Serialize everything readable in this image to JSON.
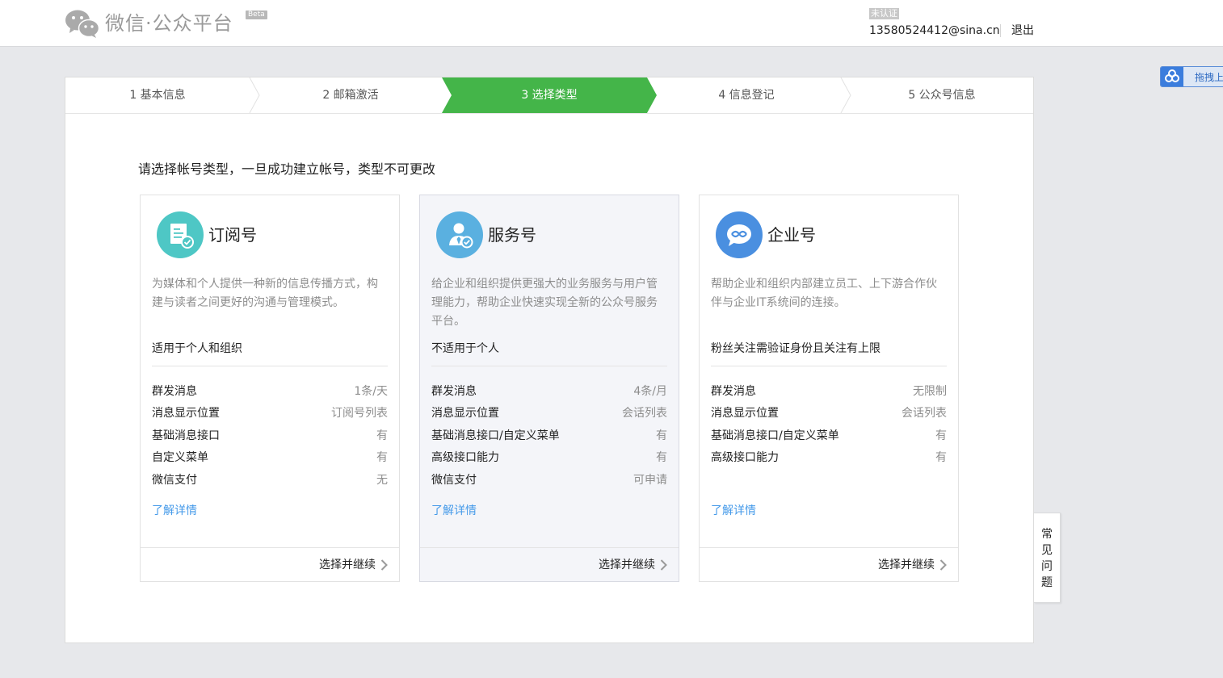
{
  "header": {
    "logo_text": "微信·公众平台",
    "beta": "Beta",
    "account_status": "未认证",
    "account_email": "13580524412@sina.cn",
    "logout": "退出"
  },
  "widgets": {
    "drag_label": "拖拽上",
    "faq_label": "常见问题"
  },
  "steps": [
    {
      "label": "1 基本信息",
      "active": false
    },
    {
      "label": "2 邮箱激活",
      "active": false
    },
    {
      "label": "3 选择类型",
      "active": true
    },
    {
      "label": "4 信息登记",
      "active": false
    },
    {
      "label": "5 公众号信息",
      "active": false
    }
  ],
  "prompt": "请选择帐号类型，一旦成功建立帐号，类型不可更改",
  "cards": [
    {
      "title": "订阅号",
      "icon": "subscription-doc-icon",
      "icon_color": "#4ec7c5",
      "desc": "为媒体和个人提供一种新的信息传播方式，构建与读者之间更好的沟通与管理模式。",
      "fit": "适用于个人和组织",
      "features": [
        {
          "name": "群发消息",
          "value": "1条/天"
        },
        {
          "name": "消息显示位置",
          "value": "订阅号列表"
        },
        {
          "name": "基础消息接口",
          "value": "有"
        },
        {
          "name": "自定义菜单",
          "value": "有"
        },
        {
          "name": "微信支付",
          "value": "无"
        }
      ],
      "detail_link": "了解详情",
      "select": "选择并继续"
    },
    {
      "title": "服务号",
      "icon": "service-person-icon",
      "icon_color": "#5ab0e0",
      "desc": "给企业和组织提供更强大的业务服务与用户管理能力，帮助企业快速实现全新的公众号服务平台。",
      "fit": "不适用于个人",
      "features": [
        {
          "name": "群发消息",
          "value": "4条/月"
        },
        {
          "name": "消息显示位置",
          "value": "会话列表"
        },
        {
          "name": "基础消息接口/自定义菜单",
          "value": "有"
        },
        {
          "name": "高级接口能力",
          "value": "有"
        },
        {
          "name": "微信支付",
          "value": "可申请"
        }
      ],
      "detail_link": "了解详情",
      "select": "选择并继续"
    },
    {
      "title": "企业号",
      "icon": "enterprise-chat-icon",
      "icon_color": "#4a8fe0",
      "desc": "帮助企业和组织内部建立员工、上下游合作伙伴与企业IT系统间的连接。",
      "fit": "粉丝关注需验证身份且关注有上限",
      "features": [
        {
          "name": "群发消息",
          "value": "无限制"
        },
        {
          "name": "消息显示位置",
          "value": "会话列表"
        },
        {
          "name": "基础消息接口/自定义菜单",
          "value": "有"
        },
        {
          "name": "高级接口能力",
          "value": "有"
        }
      ],
      "detail_link": "了解详情",
      "select": "选择并继续"
    }
  ],
  "colors": {
    "active_step": "#44b549",
    "link": "#459ae9"
  }
}
